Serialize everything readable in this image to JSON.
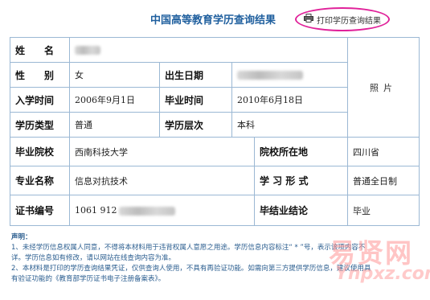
{
  "title": "中国高等教育学历查询结果",
  "print_button": {
    "label": "打印学历查询结果",
    "icon": "printer-icon"
  },
  "colors": {
    "title": "#1f5f9e",
    "border": "#9bb8d4",
    "highlight_circle": "#e0229a",
    "notes": "#2a5d8f"
  },
  "record": {
    "name_label": "姓　　名",
    "gender_label": "性　　别",
    "gender_value": "女",
    "birthdate_label": "出生日期",
    "enroll_label": "入学时间",
    "enroll_value": "2006年9月1日",
    "graduate_label": "毕业时间",
    "graduate_value": "2010年6月18日",
    "edu_type_label": "学历类型",
    "edu_type_value": "普通",
    "edu_level_label": "学历层次",
    "edu_level_value": "本科",
    "school_label": "毕业院校",
    "school_value": "西南科技大学",
    "school_location_label": "院校所在地",
    "school_location_value": "四川省",
    "major_label": "专业名称",
    "major_value": "信息对抗技术",
    "study_form_label": "学 习 形 式",
    "study_form_value": "普通全日制",
    "cert_label": "证书编号",
    "cert_value_visible": "1061 912",
    "conclusion_label": "毕结业结论",
    "conclusion_value": "毕业",
    "photo_label": "照片"
  },
  "notes": {
    "title": "声明：",
    "line1": "1、未经学历信息权属人同意，不得将本材料用于违背权属人意愿之用途。学历信息内容标注“ * ”号，表示该项内容不",
    "line2": "详。学历信息如有修改，请以网站在线查询内容为准。",
    "line3": "2、本材料是打印的学历查询结果凭证，仅供查询人使用，不具有再验证功能。如需向第三方提供学历信息，建议使用具",
    "line4": "有验证功能的《教育部学历证书电子注册备案表》。"
  },
  "watermark": {
    "text_cn": "易贤网",
    "text_en": "Ynpxz.com"
  }
}
